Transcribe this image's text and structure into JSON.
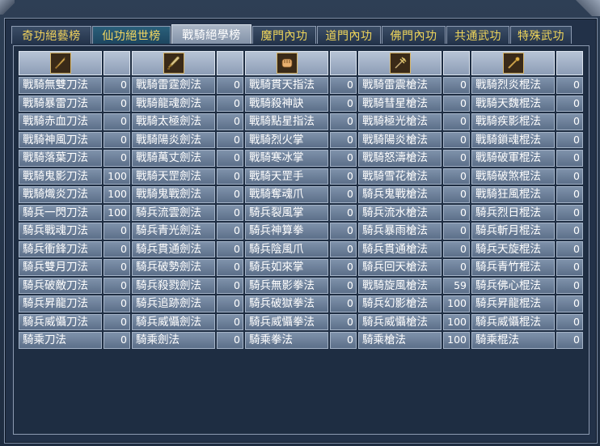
{
  "tabs": [
    {
      "label": "奇功絕藝榜",
      "active": false
    },
    {
      "label": "仙功絕世榜",
      "active": false
    },
    {
      "label": "戰騎絕學榜",
      "active": true
    },
    {
      "label": "魔門內功",
      "active": false
    },
    {
      "label": "道門內功",
      "active": false
    },
    {
      "label": "佛門內功",
      "active": false
    },
    {
      "label": "共通武功",
      "active": false
    },
    {
      "label": "特殊武功",
      "active": false
    }
  ],
  "columns": [
    {
      "icon": "blade-icon",
      "rows": [
        {
          "name": "戰騎無雙刀法",
          "value": "0"
        },
        {
          "name": "戰騎暴雷刀法",
          "value": "0"
        },
        {
          "name": "戰騎赤血刀法",
          "value": "0"
        },
        {
          "name": "戰騎神風刀法",
          "value": "0"
        },
        {
          "name": "戰騎落葉刀法",
          "value": "0"
        },
        {
          "name": "戰騎鬼影刀法",
          "value": "100"
        },
        {
          "name": "戰騎熾炎刀法",
          "value": "100"
        },
        {
          "name": "騎兵一閃刀法",
          "value": "100"
        },
        {
          "name": "騎兵戰魂刀法",
          "value": "0"
        },
        {
          "name": "騎兵衝鋒刀法",
          "value": "0"
        },
        {
          "name": "騎兵雙月刀法",
          "value": "0"
        },
        {
          "name": "騎兵破敵刀法",
          "value": "0"
        },
        {
          "name": "騎兵昇龍刀法",
          "value": "0"
        },
        {
          "name": "騎兵威懾刀法",
          "value": "0"
        },
        {
          "name": "騎乘刀法",
          "value": "0"
        }
      ]
    },
    {
      "icon": "sword-icon",
      "rows": [
        {
          "name": "戰騎雷霆劍法",
          "value": "0"
        },
        {
          "name": "戰騎龍魂劍法",
          "value": "0"
        },
        {
          "name": "戰騎太極劍法",
          "value": "0"
        },
        {
          "name": "戰騎陽炎劍法",
          "value": "0"
        },
        {
          "name": "戰騎萬丈劍法",
          "value": "0"
        },
        {
          "name": "戰騎天罡劍法",
          "value": "0"
        },
        {
          "name": "戰騎鬼戰劍法",
          "value": "0"
        },
        {
          "name": "騎兵流雲劍法",
          "value": "0"
        },
        {
          "name": "騎兵青光劍法",
          "value": "0"
        },
        {
          "name": "騎兵貫通劍法",
          "value": "0"
        },
        {
          "name": "騎兵破勢劍法",
          "value": "0"
        },
        {
          "name": "騎兵殺戮劍法",
          "value": "0"
        },
        {
          "name": "騎兵追跡劍法",
          "value": "0"
        },
        {
          "name": "騎兵威懾劍法",
          "value": "0"
        },
        {
          "name": "騎乘劍法",
          "value": "0"
        }
      ]
    },
    {
      "icon": "fist-icon",
      "rows": [
        {
          "name": "戰騎貫天指法",
          "value": "0"
        },
        {
          "name": "戰騎殺神訣",
          "value": "0"
        },
        {
          "name": "戰騎點星指法",
          "value": "0"
        },
        {
          "name": "戰騎烈火掌",
          "value": "0"
        },
        {
          "name": "戰騎寒冰掌",
          "value": "0"
        },
        {
          "name": "戰騎天罡手",
          "value": "0"
        },
        {
          "name": "戰騎奪魂爪",
          "value": "0"
        },
        {
          "name": "騎兵裂風掌",
          "value": "0"
        },
        {
          "name": "騎兵神算拳",
          "value": "0"
        },
        {
          "name": "騎兵陰風爪",
          "value": "0"
        },
        {
          "name": "騎兵如來掌",
          "value": "0"
        },
        {
          "name": "騎兵無影拳法",
          "value": "0"
        },
        {
          "name": "騎兵破獄拳法",
          "value": "0"
        },
        {
          "name": "騎兵威懾拳法",
          "value": "0"
        },
        {
          "name": "騎乘拳法",
          "value": "0"
        }
      ]
    },
    {
      "icon": "trident-icon",
      "rows": [
        {
          "name": "戰騎雷震槍法",
          "value": "0"
        },
        {
          "name": "戰騎彗星槍法",
          "value": "0"
        },
        {
          "name": "戰騎極光槍法",
          "value": "0"
        },
        {
          "name": "戰騎陽炎槍法",
          "value": "0"
        },
        {
          "name": "戰騎怒濤槍法",
          "value": "0"
        },
        {
          "name": "戰騎雪花槍法",
          "value": "0"
        },
        {
          "name": "騎兵鬼戰槍法",
          "value": "0"
        },
        {
          "name": "騎兵流水槍法",
          "value": "0"
        },
        {
          "name": "騎兵暴雨槍法",
          "value": "0"
        },
        {
          "name": "騎兵貫通槍法",
          "value": "0"
        },
        {
          "name": "騎兵回天槍法",
          "value": "0"
        },
        {
          "name": "戰騎旋風槍法",
          "value": "59"
        },
        {
          "name": "騎兵幻影槍法",
          "value": "100"
        },
        {
          "name": "騎兵威懾槍法",
          "value": "100"
        },
        {
          "name": "騎乘槍法",
          "value": "100"
        }
      ]
    },
    {
      "icon": "staff-icon",
      "rows": [
        {
          "name": "戰騎烈炎棍法",
          "value": "0"
        },
        {
          "name": "戰騎天魏棍法",
          "value": "0"
        },
        {
          "name": "戰騎疾影棍法",
          "value": "0"
        },
        {
          "name": "戰騎鎖魂棍法",
          "value": "0"
        },
        {
          "name": "戰騎破軍棍法",
          "value": "0"
        },
        {
          "name": "戰騎破煞棍法",
          "value": "0"
        },
        {
          "name": "戰騎狂風棍法",
          "value": "0"
        },
        {
          "name": "騎兵烈日棍法",
          "value": "0"
        },
        {
          "name": "騎兵斬月棍法",
          "value": "0"
        },
        {
          "name": "騎兵天旋棍法",
          "value": "0"
        },
        {
          "name": "騎兵青竹棍法",
          "value": "0"
        },
        {
          "name": "騎兵佛心棍法",
          "value": "0"
        },
        {
          "name": "騎兵昇龍棍法",
          "value": "0"
        },
        {
          "name": "騎兵威懾棍法",
          "value": "0"
        },
        {
          "name": "騎乘棍法",
          "value": "0"
        }
      ]
    }
  ]
}
